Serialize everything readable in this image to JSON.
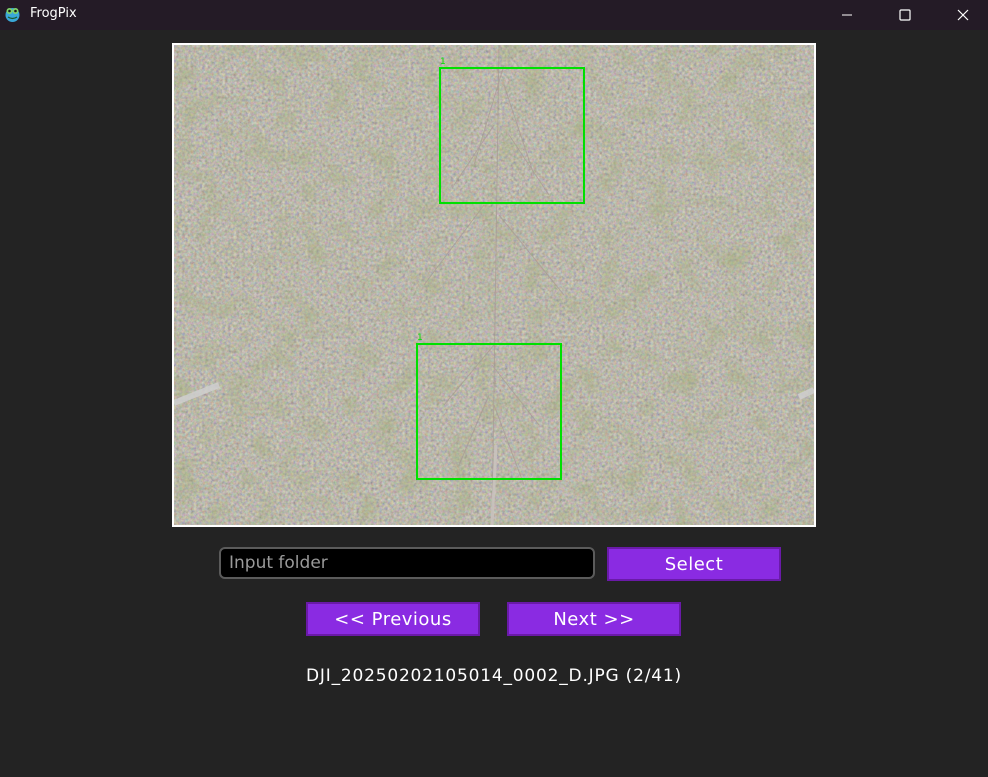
{
  "window": {
    "title": "FrogPix",
    "icon": "frog-app-icon",
    "controls": {
      "minimize_icon": "minimize-icon",
      "maximize_icon": "maximize-icon",
      "close_icon": "close-icon"
    }
  },
  "viewer": {
    "detections": [
      {
        "label": "1"
      },
      {
        "label": "1"
      }
    ],
    "box_color": "#00e000"
  },
  "controls": {
    "folder_input": {
      "placeholder": "Input folder",
      "value": ""
    },
    "select_label": "Select",
    "previous_label": "<< Previous",
    "next_label": "Next >>"
  },
  "status": {
    "filename_text": "DJI_20250202105014_0002_D.JPG (2/41)"
  },
  "colors": {
    "background": "#232323",
    "titlebar": "#241b26",
    "accent": "#8a2be2",
    "detection_box": "#00e000"
  }
}
